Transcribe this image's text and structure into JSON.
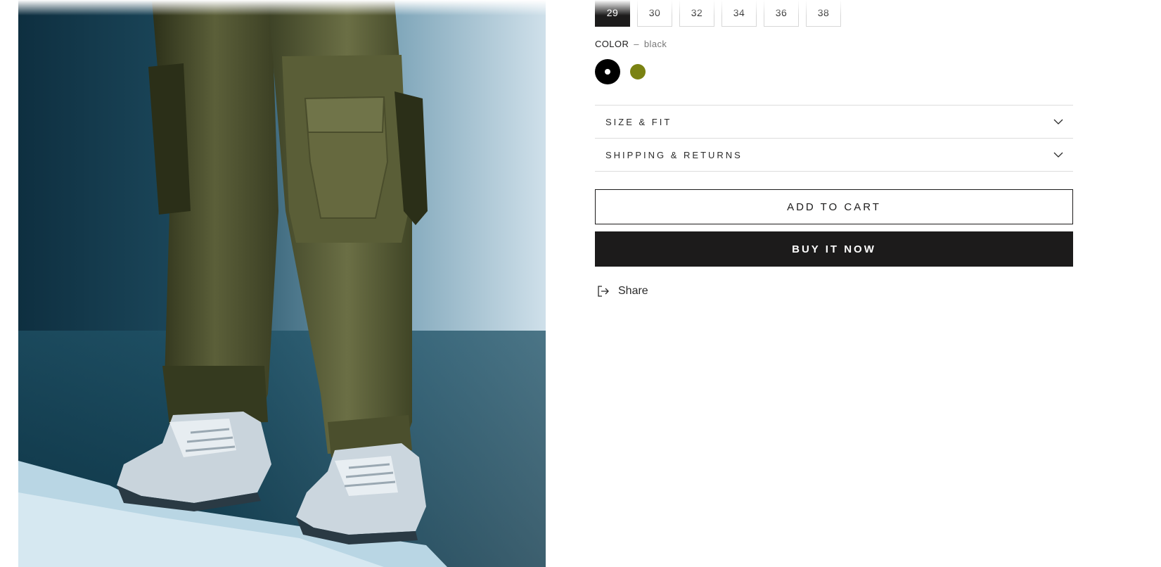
{
  "product": {
    "sizes": [
      {
        "label": "29",
        "selected": true
      },
      {
        "label": "30",
        "selected": false
      },
      {
        "label": "32",
        "selected": false
      },
      {
        "label": "34",
        "selected": false
      },
      {
        "label": "36",
        "selected": false
      },
      {
        "label": "38",
        "selected": false
      }
    ],
    "color": {
      "label": "COLOR",
      "separator": "–",
      "selected_value": "black",
      "swatches": [
        {
          "name": "black",
          "hex": "#000000"
        },
        {
          "name": "olive",
          "hex": "#7a8212"
        }
      ]
    },
    "accordion": [
      {
        "label": "SIZE & FIT"
      },
      {
        "label": "SHIPPING & RETURNS"
      }
    ],
    "add_to_cart_label": "ADD TO CART",
    "buy_now_label": "BUY IT NOW",
    "share_label": "Share"
  },
  "colors": {
    "primary": "#1c1b1b",
    "border": "#dcdcdc",
    "backdrop": "#1d4a5e"
  },
  "icons": {
    "chevron": "chevron-down-icon",
    "share": "share-icon"
  }
}
